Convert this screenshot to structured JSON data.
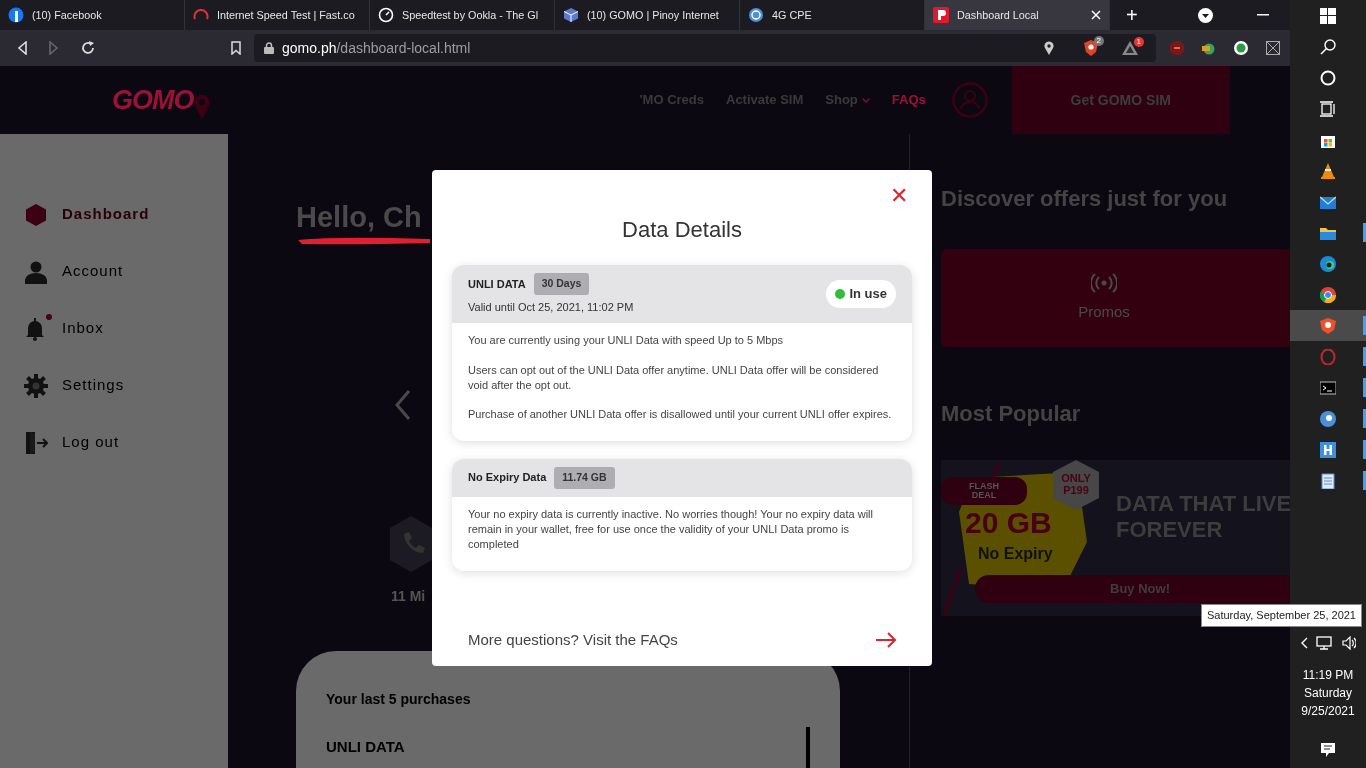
{
  "browser": {
    "tabs": [
      {
        "title": "(10) Facebook",
        "kind": "circle",
        "selected": false
      },
      {
        "title": "Internet Speed Test | Fast.co",
        "kind": "gauge",
        "selected": false
      },
      {
        "title": "Speedtest by Ookla - The Gl",
        "kind": "dial",
        "selected": false
      },
      {
        "title": "(10) GOMO | Pinoy Internet",
        "kind": "cube",
        "selected": false
      },
      {
        "title": "4G CPE",
        "kind": "globe",
        "selected": false
      },
      {
        "title": "Dashboard Local",
        "kind": "pin",
        "selected": true
      }
    ],
    "new_tab": "+",
    "forward_disabled": true,
    "url_host": "gomo.ph",
    "url_path": "/dashboard-local.html",
    "shield_count": "2",
    "rewards_count": "1"
  },
  "header": {
    "logo": "GOMO",
    "nav": [
      {
        "label": "'MO Creds",
        "selected": false,
        "has_menu": false
      },
      {
        "label": "Activate SIM",
        "selected": false,
        "has_menu": false
      },
      {
        "label": "Shop",
        "selected": false,
        "has_menu": true
      },
      {
        "label": "FAQs",
        "selected": true,
        "has_menu": false
      }
    ],
    "cta": "Get GOMO SIM"
  },
  "sidebar": {
    "items": [
      {
        "label": "Dashboard",
        "kind": "hexagon",
        "selected": true,
        "unread": false
      },
      {
        "label": "Account",
        "kind": "person",
        "selected": false,
        "unread": false
      },
      {
        "label": "Inbox",
        "kind": "bell",
        "selected": false,
        "unread": true
      },
      {
        "label": "Settings",
        "kind": "gear",
        "selected": false,
        "unread": false
      },
      {
        "label": "Log out",
        "kind": "exit",
        "selected": false,
        "unread": false
      }
    ]
  },
  "main": {
    "greeting": "Hello, Ch",
    "balance_label": "11 Mi",
    "purchases_title": "Your last 5 purchases",
    "purchases": [
      "UNLI DATA"
    ]
  },
  "offers": {
    "title": "Discover offers just for you",
    "tiles": [
      "Promos"
    ],
    "popular_title": "Most Popular",
    "banner": {
      "tag": "FLASH DEAL",
      "price": "ONLY P199",
      "amount": "20 GB",
      "subtitle": "No Expiry",
      "headline": [
        "DATA THAT LIVE",
        "FOREVER"
      ],
      "button": "Buy Now!"
    }
  },
  "modal": {
    "title": "Data Details",
    "close": "✕",
    "cards": [
      {
        "name": "UNLI DATA",
        "badge": "30 Days",
        "validity": "Valid until Oct 25, 2021, 11:02 PM",
        "status": "In use",
        "in_use": true,
        "paragraphs": [
          "You are currently using your UNLI Data with speed Up to 5 Mbps",
          "Users can opt out of the UNLI Data offer anytime. UNLI Data offer will be considered void after the opt out.",
          "Purchase of another UNLI Data offer is disallowed until your current UNLI offer expires."
        ]
      },
      {
        "name": "No Expiry Data",
        "badge": "11.74 GB",
        "paragraphs": [
          "Your no expiry data is currently inactive. No worries though! Your no expiry data will remain in your wallet, free for use once the validity of your UNLI Data promo is completed"
        ]
      }
    ],
    "footer_link": "More questions? Visit the FAQs"
  },
  "taskbar": {
    "apps": [
      {
        "kind": "windows",
        "selected": false,
        "running": false
      },
      {
        "kind": "search",
        "selected": false,
        "running": false
      },
      {
        "kind": "cortana",
        "selected": false,
        "running": false
      },
      {
        "kind": "taskview",
        "selected": false,
        "running": false
      },
      {
        "kind": "store",
        "selected": false,
        "running": false
      },
      {
        "kind": "cone",
        "selected": false,
        "running": false
      },
      {
        "kind": "mail",
        "selected": false,
        "running": false
      },
      {
        "kind": "folder",
        "selected": false,
        "running": true
      },
      {
        "kind": "swirl",
        "selected": false,
        "running": false
      },
      {
        "kind": "chrome",
        "selected": false,
        "running": false
      },
      {
        "kind": "shield",
        "selected": true,
        "running": true
      },
      {
        "kind": "ring",
        "selected": false,
        "running": true
      },
      {
        "kind": "terminal",
        "selected": false,
        "running": true
      },
      {
        "kind": "disc",
        "selected": false,
        "running": true
      },
      {
        "kind": "tile",
        "selected": false,
        "running": true
      },
      {
        "kind": "notepad",
        "selected": false,
        "running": true
      }
    ],
    "clock": {
      "time": "11:19 PM",
      "day": "Saturday",
      "date": "9/25/2021"
    },
    "tooltip": "Saturday, September 25, 2021"
  }
}
